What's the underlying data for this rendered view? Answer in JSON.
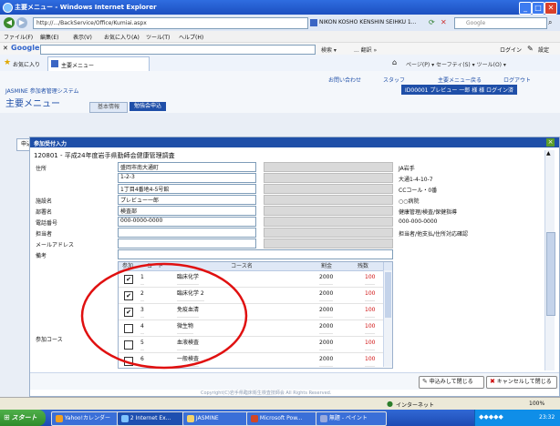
{
  "window": {
    "title": "主要メニュー - Windows Internet Explorer"
  },
  "address": {
    "url": "http://.../BackService/Office/Kumiai.aspx",
    "tab_title": "NIKON KOSHO KENSHIN SEIHKU 1...",
    "search_hint": "Google"
  },
  "menu": {
    "items": [
      "ファイル(F)",
      "編集(E)",
      "表示(V)",
      "お気に入り(A)",
      "ツール(T)",
      "ヘルプ(H)"
    ]
  },
  "google": {
    "label": "Google",
    "search_go": "検索 ▾",
    "extra": "... 翻訳 »",
    "login": "ログイン",
    "settings": "設定"
  },
  "tabs": {
    "favorites": "お気に入り",
    "page_tab": "主要メニュー",
    "tools": "ページ(P) ▾ セーフティ(S) ▾ ツール(O) ▾"
  },
  "app": {
    "brand": "JASMINE 参加者管理システム",
    "title": "主要メニュー",
    "nav_tabs": [
      "基本情報",
      "勉強会申込"
    ],
    "links": [
      "お問い合わせ",
      "スタッフ",
      "主要メニュー戻る",
      "ログアウト"
    ],
    "user_line": "ID00001 プレビュー 一郎 様 様 ログイン済"
  },
  "panel": {
    "side_tab": "申込",
    "title": "参加受付入力",
    "subtitle": "120801 - 平成24年度岩手県勤師会健康管理調査",
    "rows": [
      {
        "label": "住所",
        "value": "盛岡市南大通町"
      },
      {
        "label": "",
        "value": "1-2-3"
      },
      {
        "label": "",
        "value": "1丁目4番地4-5号館"
      },
      {
        "label": "施設名",
        "value": "プレビュー一郎"
      },
      {
        "label": "部署名",
        "value": "検査部"
      },
      {
        "label": "電話番号",
        "value": "000-0000-0000"
      },
      {
        "label": "担当者",
        "value": ""
      },
      {
        "label": "メールアドレス",
        "value": ""
      },
      {
        "label": "備考",
        "value": ""
      }
    ],
    "right_labels": [
      "JA岩手",
      "大通1-4-10-7",
      "CCコール・0番",
      "○○病院",
      "健康管理/検査/保健指導",
      "000-000-0000",
      "担当者/他支払/住所対応確認"
    ],
    "course_label": "参加コース",
    "table": {
      "headers": [
        "参加",
        "コード",
        "コース名",
        "割金",
        "残数"
      ],
      "rows": [
        {
          "checked": "✔",
          "code": "1",
          "name": "臨床化学",
          "price": "2000",
          "remain": "100"
        },
        {
          "checked": "✔",
          "code": "2",
          "name": "臨床化学 2",
          "price": "2000",
          "remain": "100"
        },
        {
          "checked": "✔",
          "code": "3",
          "name": "免疫血清",
          "price": "2000",
          "remain": "100"
        },
        {
          "checked": "",
          "code": "4",
          "name": "微生物",
          "price": "2000",
          "remain": "100"
        },
        {
          "checked": "",
          "code": "5",
          "name": "血液検査",
          "price": "2000",
          "remain": "100"
        },
        {
          "checked": "",
          "code": "6",
          "name": "一般検査",
          "price": "2000",
          "remain": "100"
        }
      ]
    },
    "buttons": {
      "submit": "申込みして閉じる",
      "cancel": "キャンセルして閉じる"
    },
    "copyright": "Copyright(C)岩手県臨床衛生検査技師会 All Rights Reserved."
  },
  "status": {
    "zone": "インターネット",
    "zoom": "100%"
  },
  "taskbar": {
    "start": "スタート",
    "items": [
      "Yahoo!カレンダー",
      "2 Internet Ex...",
      "JASMINE",
      "Microsoft Pow...",
      "無題 - ペイント"
    ],
    "clock": "23:32"
  },
  "colors": {
    "annotation": "#e01010",
    "brand": "#1f4fa8",
    "remain": "#d01010"
  }
}
